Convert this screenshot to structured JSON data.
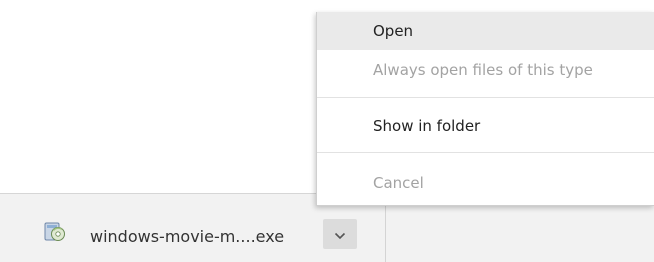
{
  "download_shelf": {
    "file_name": "windows-movie-m....exe",
    "file_icon": "installer-disc-icon",
    "chevron_icon": "chevron-down-icon"
  },
  "context_menu": {
    "items": [
      {
        "label": "Open",
        "enabled": true,
        "highlighted": true
      },
      {
        "label": "Always open files of this type",
        "enabled": false
      },
      {
        "label": "Show in folder",
        "enabled": true
      },
      {
        "label": "Cancel",
        "enabled": false
      }
    ]
  },
  "colors": {
    "menu_highlight": "#eaeaea",
    "disabled_text": "#a3a3a3",
    "shelf_background": "#f2f2f2",
    "chevron_button": "#dcdcdc"
  }
}
